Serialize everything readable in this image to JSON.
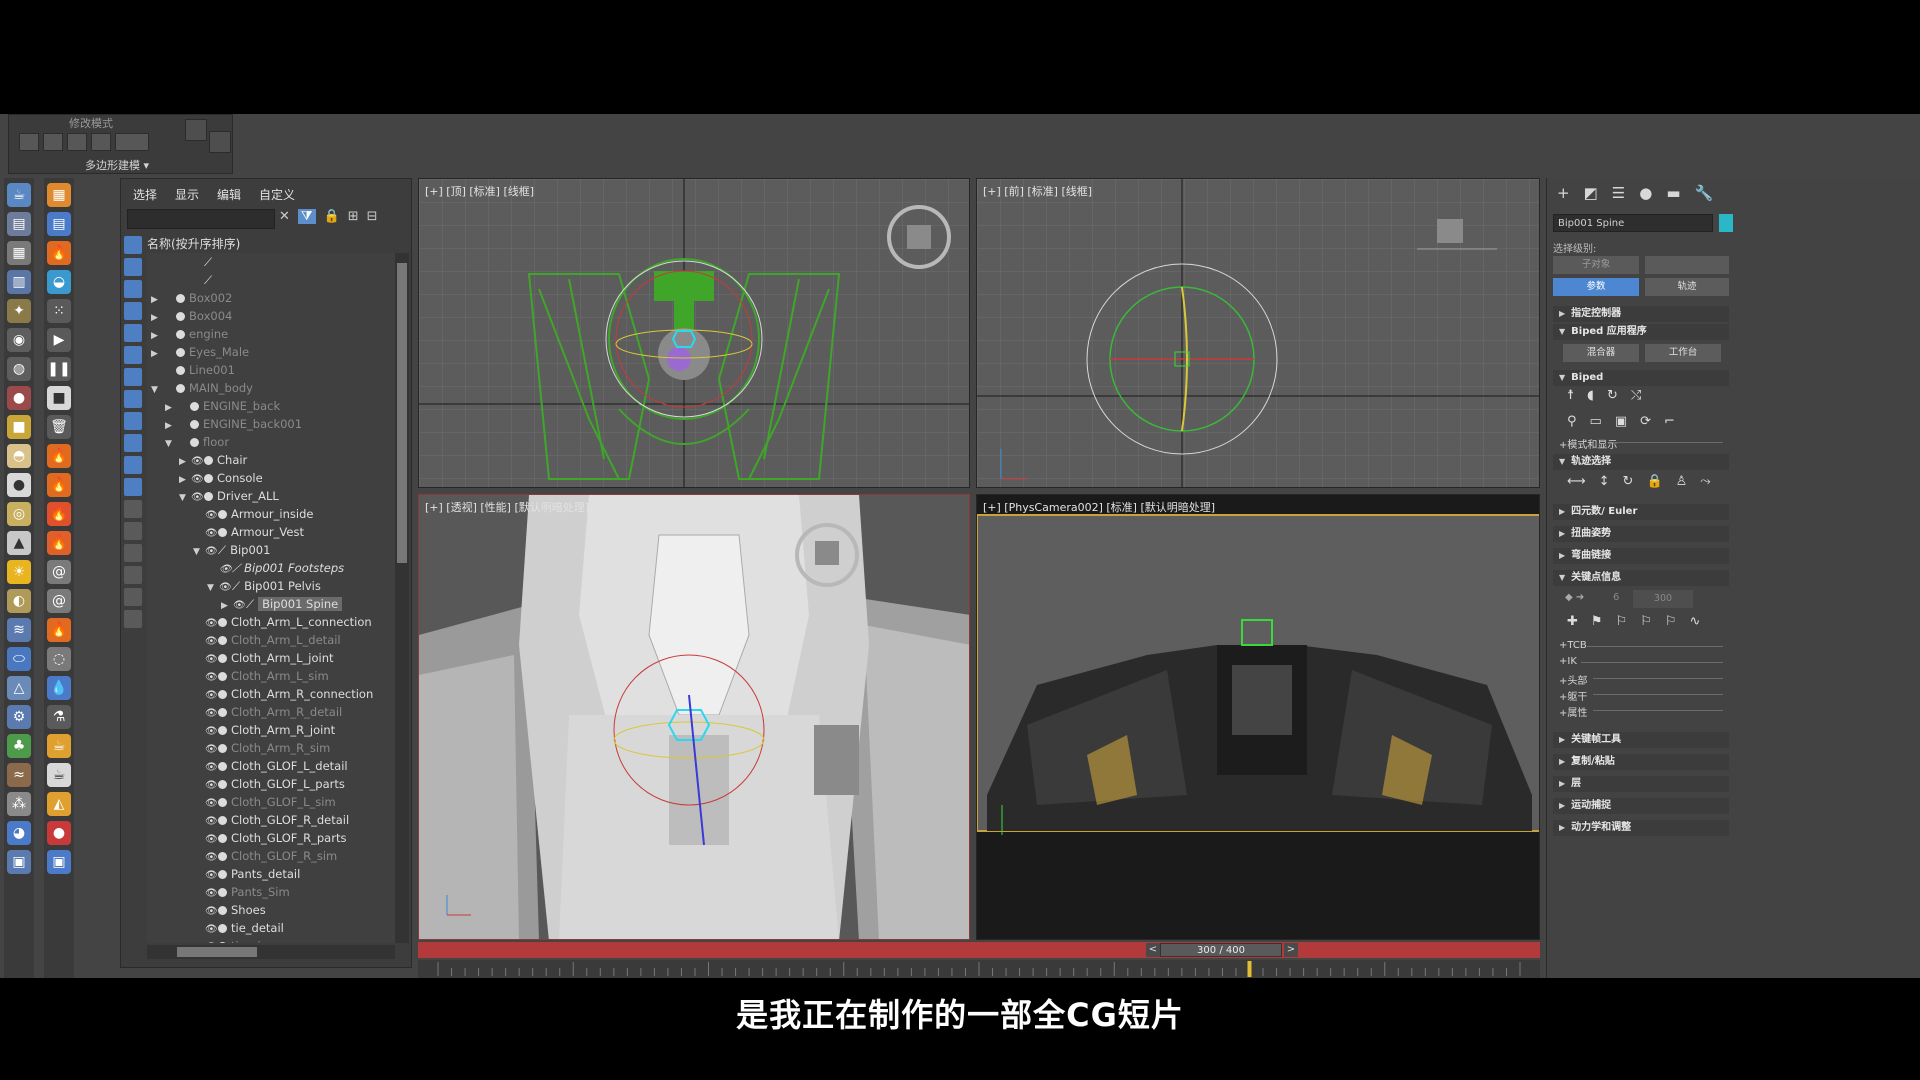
{
  "subtitle": "是我正在制作的一部全CG短片",
  "ribbon": {
    "mode_title": "修改模式",
    "poly_label": "多边形建模 ▾"
  },
  "explorer": {
    "menu": [
      "选择",
      "显示",
      "编辑",
      "自定义"
    ],
    "column_header": "名称(按升序排序)",
    "rows": [
      {
        "indent": 2,
        "arrow": "",
        "eye": "",
        "label": "",
        "dim": false,
        "italic": false,
        "sel": false,
        "icon": "bone"
      },
      {
        "indent": 2,
        "arrow": "",
        "eye": "",
        "label": "",
        "dim": false,
        "italic": false,
        "sel": false,
        "icon": "bone"
      },
      {
        "indent": 0,
        "arrow": "▶",
        "eye": "",
        "label": "Box002",
        "dim": true,
        "italic": false,
        "sel": false,
        "icon": "dot"
      },
      {
        "indent": 0,
        "arrow": "▶",
        "eye": "",
        "label": "Box004",
        "dim": true,
        "italic": false,
        "sel": false,
        "icon": "dot"
      },
      {
        "indent": 0,
        "arrow": "▶",
        "eye": "",
        "label": "engine",
        "dim": true,
        "italic": false,
        "sel": false,
        "icon": "dot"
      },
      {
        "indent": 0,
        "arrow": "▶",
        "eye": "",
        "label": "Eyes_Male",
        "dim": true,
        "italic": false,
        "sel": false,
        "icon": "dot"
      },
      {
        "indent": 0,
        "arrow": "",
        "eye": "",
        "label": "Line001",
        "dim": true,
        "italic": false,
        "sel": false,
        "icon": "dot"
      },
      {
        "indent": 0,
        "arrow": "▼",
        "eye": "",
        "label": "MAIN_body",
        "dim": true,
        "italic": false,
        "sel": false,
        "icon": "dot"
      },
      {
        "indent": 1,
        "arrow": "▶",
        "eye": "",
        "label": "ENGINE_back",
        "dim": true,
        "italic": false,
        "sel": false,
        "icon": "dot"
      },
      {
        "indent": 1,
        "arrow": "▶",
        "eye": "",
        "label": "ENGINE_back001",
        "dim": true,
        "italic": false,
        "sel": false,
        "icon": "dot"
      },
      {
        "indent": 1,
        "arrow": "▼",
        "eye": "",
        "label": "floor",
        "dim": true,
        "italic": false,
        "sel": false,
        "icon": "dot"
      },
      {
        "indent": 2,
        "arrow": "▶",
        "eye": "👁",
        "label": "Chair",
        "dim": false,
        "italic": false,
        "sel": false,
        "icon": "dot"
      },
      {
        "indent": 2,
        "arrow": "▶",
        "eye": "👁",
        "label": "Console",
        "dim": false,
        "italic": false,
        "sel": false,
        "icon": "dot"
      },
      {
        "indent": 2,
        "arrow": "▼",
        "eye": "👁",
        "label": "Driver_ALL",
        "dim": false,
        "italic": false,
        "sel": false,
        "icon": "dot"
      },
      {
        "indent": 3,
        "arrow": "",
        "eye": "👁",
        "label": "Armour_inside",
        "dim": false,
        "italic": false,
        "sel": false,
        "icon": "dot"
      },
      {
        "indent": 3,
        "arrow": "",
        "eye": "👁",
        "label": "Armour_Vest",
        "dim": false,
        "italic": false,
        "sel": false,
        "icon": "dot"
      },
      {
        "indent": 3,
        "arrow": "▼",
        "eye": "👁",
        "label": "Bip001",
        "dim": false,
        "italic": false,
        "sel": false,
        "icon": "bone"
      },
      {
        "indent": 4,
        "arrow": "",
        "eye": "👁",
        "label": "Bip001 Footsteps",
        "dim": false,
        "italic": true,
        "sel": false,
        "icon": "bone"
      },
      {
        "indent": 4,
        "arrow": "▼",
        "eye": "👁",
        "label": "Bip001 Pelvis",
        "dim": false,
        "italic": false,
        "sel": false,
        "icon": "bone"
      },
      {
        "indent": 5,
        "arrow": "▶",
        "eye": "👁",
        "label": "Bip001 Spine",
        "dim": false,
        "italic": false,
        "sel": true,
        "icon": "bone"
      },
      {
        "indent": 3,
        "arrow": "",
        "eye": "👁",
        "label": "Cloth_Arm_L_connection",
        "dim": false,
        "italic": false,
        "sel": false,
        "icon": "dot"
      },
      {
        "indent": 3,
        "arrow": "",
        "eye": "👁",
        "label": "Cloth_Arm_L_detail",
        "dim": true,
        "italic": false,
        "sel": false,
        "icon": "dot"
      },
      {
        "indent": 3,
        "arrow": "",
        "eye": "👁",
        "label": "Cloth_Arm_L_joint",
        "dim": false,
        "italic": false,
        "sel": false,
        "icon": "dot"
      },
      {
        "indent": 3,
        "arrow": "",
        "eye": "👁",
        "label": "Cloth_Arm_L_sim",
        "dim": true,
        "italic": false,
        "sel": false,
        "icon": "dot"
      },
      {
        "indent": 3,
        "arrow": "",
        "eye": "👁",
        "label": "Cloth_Arm_R_connection",
        "dim": false,
        "italic": false,
        "sel": false,
        "icon": "dot"
      },
      {
        "indent": 3,
        "arrow": "",
        "eye": "👁",
        "label": "Cloth_Arm_R_detail",
        "dim": true,
        "italic": false,
        "sel": false,
        "icon": "dot"
      },
      {
        "indent": 3,
        "arrow": "",
        "eye": "👁",
        "label": "Cloth_Arm_R_joint",
        "dim": false,
        "italic": false,
        "sel": false,
        "icon": "dot"
      },
      {
        "indent": 3,
        "arrow": "",
        "eye": "👁",
        "label": "Cloth_Arm_R_sim",
        "dim": true,
        "italic": false,
        "sel": false,
        "icon": "dot"
      },
      {
        "indent": 3,
        "arrow": "",
        "eye": "👁",
        "label": "Cloth_GLOF_L_detail",
        "dim": false,
        "italic": false,
        "sel": false,
        "icon": "dot"
      },
      {
        "indent": 3,
        "arrow": "",
        "eye": "👁",
        "label": "Cloth_GLOF_L_parts",
        "dim": false,
        "italic": false,
        "sel": false,
        "icon": "dot"
      },
      {
        "indent": 3,
        "arrow": "",
        "eye": "👁",
        "label": "Cloth_GLOF_L_sim",
        "dim": true,
        "italic": false,
        "sel": false,
        "icon": "dot"
      },
      {
        "indent": 3,
        "arrow": "",
        "eye": "👁",
        "label": "Cloth_GLOF_R_detail",
        "dim": false,
        "italic": false,
        "sel": false,
        "icon": "dot"
      },
      {
        "indent": 3,
        "arrow": "",
        "eye": "👁",
        "label": "Cloth_GLOF_R_parts",
        "dim": false,
        "italic": false,
        "sel": false,
        "icon": "dot"
      },
      {
        "indent": 3,
        "arrow": "",
        "eye": "👁",
        "label": "Cloth_GLOF_R_sim",
        "dim": true,
        "italic": false,
        "sel": false,
        "icon": "dot"
      },
      {
        "indent": 3,
        "arrow": "",
        "eye": "👁",
        "label": "Pants_detail",
        "dim": false,
        "italic": false,
        "sel": false,
        "icon": "dot"
      },
      {
        "indent": 3,
        "arrow": "",
        "eye": "👁",
        "label": "Pants_Sim",
        "dim": true,
        "italic": false,
        "sel": false,
        "icon": "dot"
      },
      {
        "indent": 3,
        "arrow": "",
        "eye": "👁",
        "label": "Shoes",
        "dim": false,
        "italic": false,
        "sel": false,
        "icon": "dot"
      },
      {
        "indent": 3,
        "arrow": "",
        "eye": "👁",
        "label": "tie_detail",
        "dim": false,
        "italic": false,
        "sel": false,
        "icon": "dot"
      },
      {
        "indent": 3,
        "arrow": "",
        "eye": "👁",
        "label": "tie_sim",
        "dim": true,
        "italic": false,
        "sel": false,
        "icon": "dot"
      }
    ]
  },
  "viewports": {
    "top": "[+] [顶] [标准] [线框]",
    "front": "[+] [前] [标准] [线框]",
    "persp": "[+] [透视] [性能] [默认明暗处理]",
    "camera": "[+] [PhysCamera002] [标准] [默认明暗处理]"
  },
  "timeline": {
    "frame_label": "300 / 400",
    "prev": "<",
    "next": ">",
    "current": 300,
    "total": 400
  },
  "command_panel": {
    "object_name": "Bip001 Spine",
    "object_color": "#2ab8c9",
    "select_level_label": "选择级别:",
    "sub_object_btn": "子对象",
    "params_btn": "参数",
    "track_btn": "轨迹",
    "rollouts": {
      "assign_controller": "指定控制器",
      "biped_apps": "Biped 应用程序",
      "mixer_btn": "混合器",
      "workbench_btn": "工作台",
      "biped": "Biped",
      "mode_display": "+模式和显示",
      "track_select": "轨迹选择",
      "quat_euler": "四元数/ Euler",
      "twist_pose": "扭曲姿势",
      "bend_links": "弯曲链接",
      "key_info": "关键点信息",
      "key_index": "6",
      "key_time": "300",
      "tcb": "+TCB",
      "ik": "+IK",
      "head": "+头部",
      "body": "+躯干",
      "props": "+属性",
      "key_tools": "关键帧工具",
      "copy_paste": "复制/粘贴",
      "layers": "层",
      "motion_capture": "运动捕捉",
      "dynamics": "动力学和调整"
    }
  }
}
